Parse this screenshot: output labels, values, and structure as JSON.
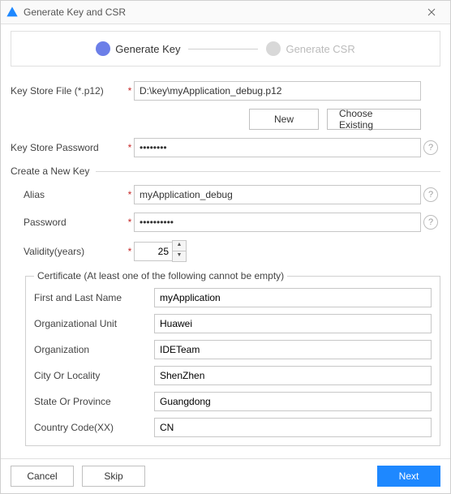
{
  "window": {
    "title": "Generate Key and CSR"
  },
  "stepper": {
    "step1": "Generate Key",
    "step2": "Generate CSR"
  },
  "fields": {
    "keyStoreFile": {
      "label": "Key Store File (*.p12)",
      "value": "D:\\key\\myApplication_debug.p12"
    },
    "keyStorePassword": {
      "label": "Key Store Password",
      "value": "••••••••"
    }
  },
  "buttons": {
    "new": "New",
    "chooseExisting": "Choose Existing",
    "cancel": "Cancel",
    "skip": "Skip",
    "next": "Next"
  },
  "createKey": {
    "heading": "Create a New Key",
    "alias": {
      "label": "Alias",
      "value": "myApplication_debug"
    },
    "password": {
      "label": "Password",
      "value": "••••••••••"
    },
    "validity": {
      "label": "Validity(years)",
      "value": "25"
    }
  },
  "certificate": {
    "legend": "Certificate (At least one of the following cannot be empty)",
    "firstLast": {
      "label": "First and Last Name",
      "value": "myApplication"
    },
    "orgUnit": {
      "label": "Organizational Unit",
      "value": "Huawei"
    },
    "org": {
      "label": "Organization",
      "value": "IDETeam"
    },
    "city": {
      "label": "City Or Locality",
      "value": "ShenZhen"
    },
    "state": {
      "label": "State Or Province",
      "value": "Guangdong"
    },
    "country": {
      "label": "Country Code(XX)",
      "value": "CN"
    }
  }
}
